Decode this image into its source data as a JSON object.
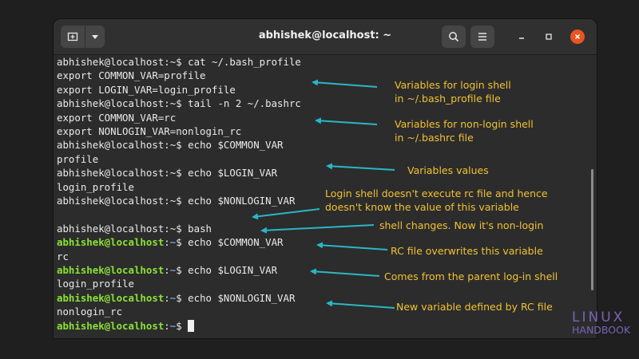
{
  "window": {
    "title": "abhishek@localhost: ~",
    "new_tab_icon": "new-tab-icon",
    "menu_caret_icon": "chevron-down-icon",
    "search_icon": "search-icon",
    "hamburger_icon": "menu-icon",
    "minimize_icon": "minimize-icon",
    "maximize_icon": "maximize-icon",
    "close_icon": "close-icon"
  },
  "colors": {
    "prompt_user": "#8ae234",
    "prompt_path": "#729fcf",
    "annotation": "#f1c232",
    "arrow": "#29b7c7",
    "close_button": "#e95420",
    "logo": "#7b62b8"
  },
  "terminal": {
    "lines": [
      {
        "user": "abhishek@localhost",
        "colored": false,
        "path": "~",
        "sym": "$",
        "cmd": " cat ~/.bash_profile"
      },
      {
        "text": "export COMMON_VAR=profile"
      },
      {
        "text": "export LOGIN_VAR=login_profile"
      },
      {
        "user": "abhishek@localhost",
        "colored": false,
        "path": "~",
        "sym": "$",
        "cmd": " tail -n 2 ~/.bashrc"
      },
      {
        "text": "export COMMON_VAR=rc"
      },
      {
        "text": "export NONLOGIN_VAR=nonlogin_rc"
      },
      {
        "user": "abhishek@localhost",
        "colored": false,
        "path": "~",
        "sym": "$",
        "cmd": " echo $COMMON_VAR"
      },
      {
        "text": "profile"
      },
      {
        "user": "abhishek@localhost",
        "colored": false,
        "path": "~",
        "sym": "$",
        "cmd": " echo $LOGIN_VAR"
      },
      {
        "text": "login_profile"
      },
      {
        "user": "abhishek@localhost",
        "colored": false,
        "path": "~",
        "sym": "$",
        "cmd": " echo $NONLOGIN_VAR"
      },
      {
        "text": ""
      },
      {
        "user": "abhishek@localhost",
        "colored": false,
        "path": "~",
        "sym": "$",
        "cmd": " bash"
      },
      {
        "user": "abhishek@localhost",
        "colored": true,
        "path": "~",
        "sym": "$",
        "cmd": " echo $COMMON_VAR"
      },
      {
        "text": "rc"
      },
      {
        "user": "abhishek@localhost",
        "colored": true,
        "path": "~",
        "sym": "$",
        "cmd": " echo $LOGIN_VAR"
      },
      {
        "text": "login_profile"
      },
      {
        "user": "abhishek@localhost",
        "colored": true,
        "path": "~",
        "sym": "$",
        "cmd": " echo $NONLOGIN_VAR"
      },
      {
        "text": "nonlogin_rc"
      },
      {
        "user": "abhishek@localhost",
        "colored": true,
        "path": "~",
        "sym": "$",
        "cmd": " ",
        "cursor": true
      }
    ]
  },
  "annotations": {
    "login_vars": "Variables for login shell\nin ~/.bash_profile file",
    "nonlogin_vars": "Variables for non-login shell\nin ~/.bashrc file",
    "values": "Variables values",
    "login_no_rc": "Login shell doesn't execute rc file and hence\ndoesn't know the value of this variable",
    "shell_changes": "shell changes. Now it's non-login",
    "rc_overwrites": "RC file overwrites this variable",
    "parent_shell": "Comes from the parent log-in shell",
    "new_variable": "New variable defined by RC file"
  },
  "logo": {
    "top": "LINUX",
    "bottom": "HANDBOOK"
  }
}
